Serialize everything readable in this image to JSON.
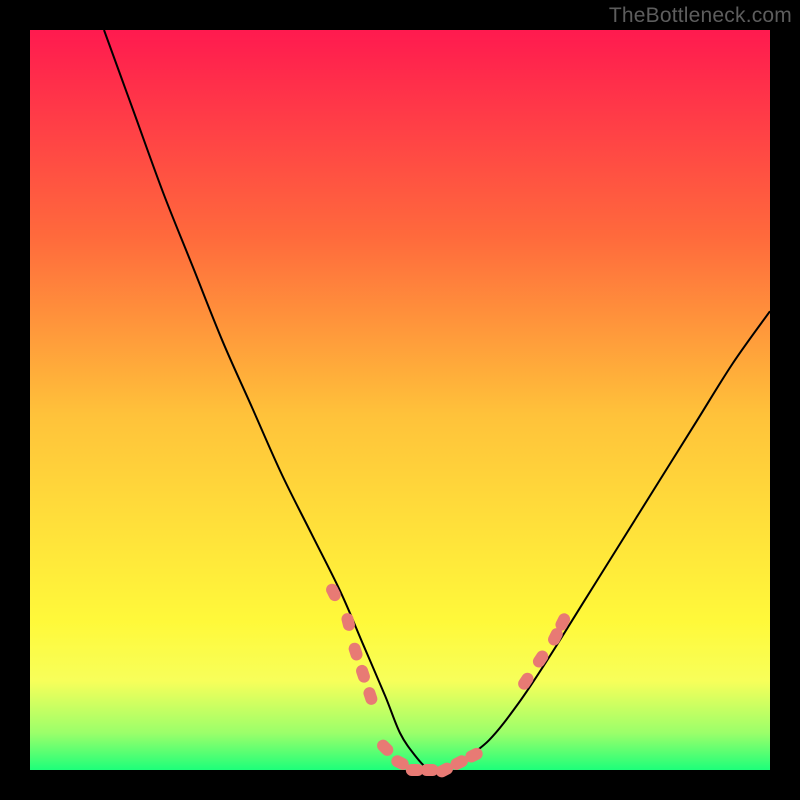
{
  "watermark": "TheBottleneck.com",
  "chart_data": {
    "type": "line",
    "title": "",
    "xlabel": "",
    "ylabel": "",
    "xlim": [
      0,
      100
    ],
    "ylim": [
      0,
      100
    ],
    "gradient_stops": [
      {
        "pct": 0,
        "color": "#ff1a4f"
      },
      {
        "pct": 28,
        "color": "#ff6a3c"
      },
      {
        "pct": 52,
        "color": "#ffc23a"
      },
      {
        "pct": 68,
        "color": "#ffe23a"
      },
      {
        "pct": 80,
        "color": "#fff93a"
      },
      {
        "pct": 88,
        "color": "#f7ff5a"
      },
      {
        "pct": 95,
        "color": "#9bff6a"
      },
      {
        "pct": 100,
        "color": "#1dff7a"
      }
    ],
    "series": [
      {
        "name": "bottleneck-curve",
        "x": [
          10,
          14,
          18,
          22,
          26,
          30,
          34,
          38,
          42,
          45,
          48,
          50,
          52,
          54,
          56,
          58,
          62,
          66,
          70,
          75,
          80,
          85,
          90,
          95,
          100
        ],
        "y": [
          100,
          89,
          78,
          68,
          58,
          49,
          40,
          32,
          24,
          17,
          10,
          5,
          2,
          0,
          0,
          1,
          4,
          9,
          15,
          23,
          31,
          39,
          47,
          55,
          62
        ]
      }
    ],
    "highlight_clusters": [
      {
        "name": "left-cluster",
        "points": [
          {
            "x": 41,
            "y": 24
          },
          {
            "x": 43,
            "y": 20
          },
          {
            "x": 44,
            "y": 16
          },
          {
            "x": 45,
            "y": 13
          },
          {
            "x": 46,
            "y": 10
          }
        ]
      },
      {
        "name": "bottom-cluster",
        "points": [
          {
            "x": 48,
            "y": 3
          },
          {
            "x": 50,
            "y": 1
          },
          {
            "x": 52,
            "y": 0
          },
          {
            "x": 54,
            "y": 0
          },
          {
            "x": 56,
            "y": 0
          },
          {
            "x": 58,
            "y": 1
          },
          {
            "x": 60,
            "y": 2
          }
        ]
      },
      {
        "name": "right-cluster",
        "points": [
          {
            "x": 67,
            "y": 12
          },
          {
            "x": 69,
            "y": 15
          },
          {
            "x": 71,
            "y": 18
          },
          {
            "x": 72,
            "y": 20
          }
        ]
      }
    ]
  }
}
